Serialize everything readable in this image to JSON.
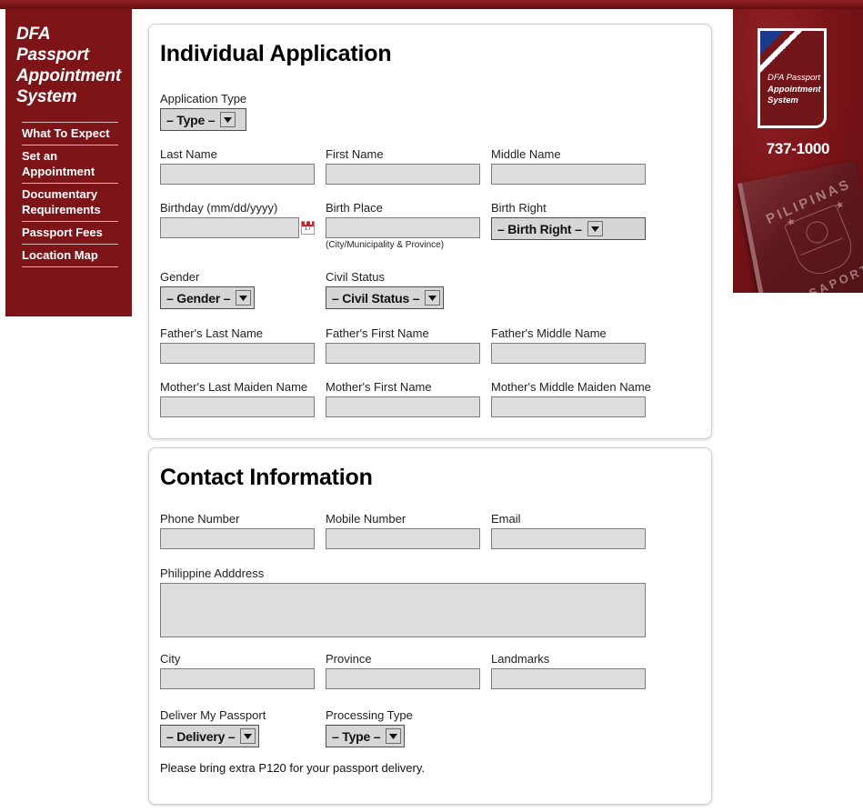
{
  "site": {
    "brand_line1": "DFA Passport",
    "brand_line2": "Appointment",
    "brand_line3": "System"
  },
  "sidebar": {
    "items": [
      {
        "label": "What To Expect"
      },
      {
        "label": "Set an Appointment"
      },
      {
        "label": "Documentary Requirements"
      },
      {
        "label": "Passport Fees"
      },
      {
        "label": "Location Map"
      }
    ]
  },
  "banner": {
    "logo_line1": "DFA Passport",
    "logo_line2": "Appointment",
    "logo_line3": "System",
    "phone": "737-1000",
    "passport_country": "PILIPINAS",
    "passport_word": "PASAPORTE"
  },
  "individual": {
    "title": "Individual Application",
    "application_type": {
      "label": "Application Type",
      "value": "– Type –"
    },
    "last_name": {
      "label": "Last Name",
      "value": ""
    },
    "first_name": {
      "label": "First Name",
      "value": ""
    },
    "middle_name": {
      "label": "Middle Name",
      "value": ""
    },
    "birthday": {
      "label": "Birthday (mm/dd/yyyy)",
      "value": ""
    },
    "birth_place": {
      "label": "Birth Place",
      "value": "",
      "hint": "(City/Municipality & Province)"
    },
    "birth_right": {
      "label": "Birth Right",
      "value": "– Birth Right –"
    },
    "gender": {
      "label": "Gender",
      "value": "– Gender –"
    },
    "civil_status": {
      "label": "Civil Status",
      "value": "– Civil Status –"
    },
    "father_last_name": {
      "label": "Father's Last Name",
      "value": ""
    },
    "father_first_name": {
      "label": "Father's First Name",
      "value": ""
    },
    "father_middle_name": {
      "label": "Father's Middle Name",
      "value": ""
    },
    "mother_last_maiden_name": {
      "label": "Mother's Last Maiden Name",
      "value": ""
    },
    "mother_first_name": {
      "label": "Mother's First Name",
      "value": ""
    },
    "mother_middle_maiden_name": {
      "label": "Mother's Middle Maiden Name",
      "value": ""
    }
  },
  "contact": {
    "title": "Contact Information",
    "phone_number": {
      "label": "Phone Number",
      "value": ""
    },
    "mobile_number": {
      "label": "Mobile Number",
      "value": ""
    },
    "email": {
      "label": "Email",
      "value": ""
    },
    "address": {
      "label": "Philippine Adddress",
      "value": ""
    },
    "city": {
      "label": "City",
      "value": ""
    },
    "province": {
      "label": "Province",
      "value": ""
    },
    "landmarks": {
      "label": "Landmarks",
      "value": ""
    },
    "delivery": {
      "label": "Deliver My Passport",
      "value": "– Delivery –"
    },
    "processing_type": {
      "label": "Processing Type",
      "value": "– Type –"
    },
    "note": "Please bring extra P120 for your passport delivery."
  },
  "icons": {
    "calendar_day": "17"
  },
  "colors": {
    "maroon": "#7c1418",
    "maroon_dark": "#5d0e12",
    "field_bg": "#dedede",
    "select_bg": "#d6d6d6",
    "fold_blue": "#1b3a8c"
  }
}
